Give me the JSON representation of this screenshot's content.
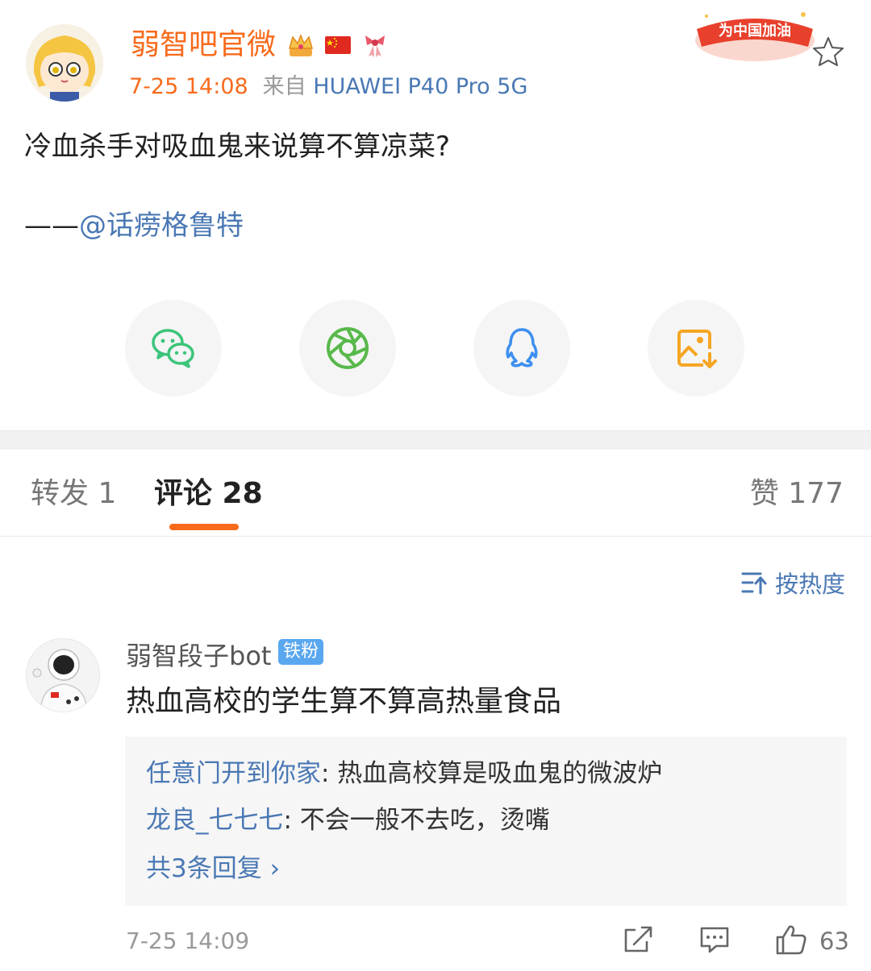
{
  "post": {
    "author": "弱智吧官微",
    "badges": [
      "crown-icon",
      "china-flag-icon",
      "ribbon-icon"
    ],
    "time": "7-25 14:08",
    "from_label": "来自",
    "source": "HUAWEI P40 Pro 5G",
    "promo_label": "为中国加油",
    "text": "冷血杀手对吸血鬼来说算不算凉菜?",
    "credit_prefix": "——",
    "credit_mention": "@话痨格鲁特"
  },
  "share": [
    "wechat-icon",
    "moments-icon",
    "qq-icon",
    "save-image-icon"
  ],
  "tabs": {
    "repost": "转发 1",
    "comment": "评论 28",
    "like": "赞 177"
  },
  "sort_label": "按热度",
  "comment": {
    "user": "弱智段子bot",
    "badge": "铁粉",
    "text": "热血高校的学生算不算高热量食品",
    "replies": [
      {
        "name": "任意门开到你家",
        "text": ": 热血高校算是吸血鬼的微波炉"
      },
      {
        "name": "龙良_七七七",
        "text": ": 不会一般不去吃，烫嘴"
      }
    ],
    "more_replies": "共3条回复 ›",
    "time": "7-25 14:09",
    "like_count": "63"
  },
  "colors": {
    "accent": "#f86b1c",
    "link": "#4a78b4",
    "badge_blue": "#5aa7f0"
  }
}
